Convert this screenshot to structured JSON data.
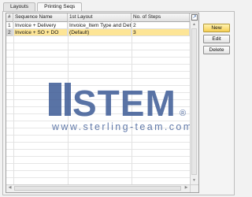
{
  "tabs": [
    {
      "label": "Layouts",
      "active": false
    },
    {
      "label": "Printing Seqs",
      "active": true
    }
  ],
  "grid": {
    "headers": [
      "#",
      "Sequence Name",
      "1st Layout",
      "No. of Steps"
    ],
    "rows": [
      {
        "num": "1",
        "name": "Invoice + Delivery",
        "layout": "Invoice_Item Type and Detail",
        "steps": "2",
        "selected": false
      },
      {
        "num": "2",
        "name": "Invoice + SO + DO",
        "layout": "(Default)",
        "steps": "3",
        "selected": true
      }
    ]
  },
  "buttons": {
    "new": "New",
    "edit": "Edit",
    "delete": "Delete"
  },
  "watermark": {
    "logo": "STEM",
    "url": "www.sterling-team.com",
    "mark": "®"
  },
  "colors": {
    "selected_row": "#fde596",
    "new_button": "#f7cf53",
    "watermark": "#3d5b96"
  },
  "icons": [
    "expand-icon"
  ]
}
